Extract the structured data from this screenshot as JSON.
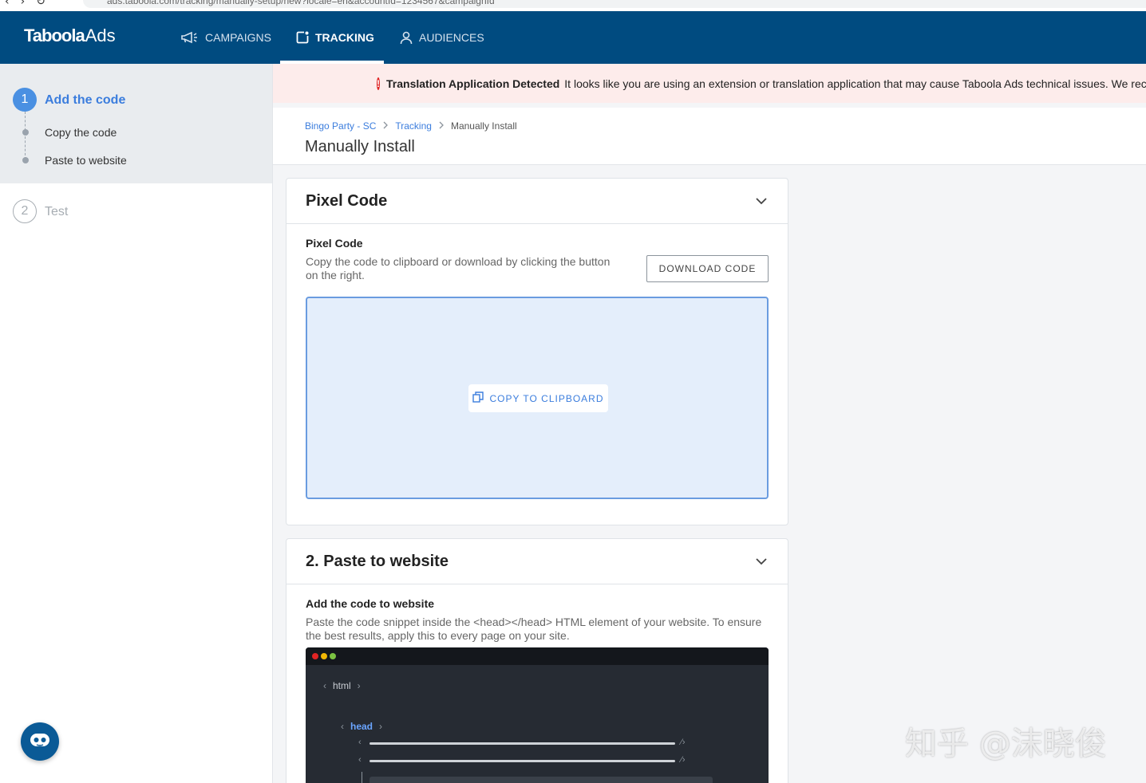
{
  "browser": {
    "url": "ads.taboola.com/tracking/manually-setup/new?locale=en&accountId=1234567&campaignId"
  },
  "header": {
    "logo_main": "Taboola",
    "logo_suffix": "Ads",
    "tabs": [
      {
        "label": "CAMPAIGNS",
        "icon": "megaphone-icon",
        "active": false
      },
      {
        "label": "TRACKING",
        "icon": "tracking-icon",
        "active": true
      },
      {
        "label": "AUDIENCES",
        "icon": "person-icon",
        "active": false
      }
    ],
    "bg_color": "#004b80"
  },
  "sidebar": {
    "step1": {
      "number": "1",
      "title": "Add the code",
      "substeps": [
        "Copy the code",
        "Paste to website"
      ]
    },
    "step2": {
      "number": "2",
      "title": "Test"
    }
  },
  "alert": {
    "title": "Translation Application Detected",
    "message": "It looks like you are using an extension or translation application that may cause Taboola Ads technical issues. We rec"
  },
  "page": {
    "breadcrumb": [
      "Bingo Party - SC",
      "Tracking",
      "Manually Install"
    ],
    "title": "Manually Install"
  },
  "pixel_card": {
    "title": "Pixel Code",
    "label": "Pixel Code",
    "description": "Copy the code to clipboard or download by clicking the button on the right.",
    "download_label": "DOWNLOAD CODE",
    "copy_label": "COPY TO CLIPBOARD"
  },
  "paste_card": {
    "title": "2. Paste to website",
    "label": "Add the code to website",
    "description": "Paste the code snippet inside the <head></head> HTML element of your website. To ensure the best results, apply this to every page on your site.",
    "mock": {
      "html_tag": "html",
      "head_tag": "head",
      "dot_colors": [
        "#e02424",
        "#f2b705",
        "#7cc242"
      ]
    }
  },
  "watermark": "知乎 @沫晓俊",
  "accent_color": "#3b7ddd"
}
